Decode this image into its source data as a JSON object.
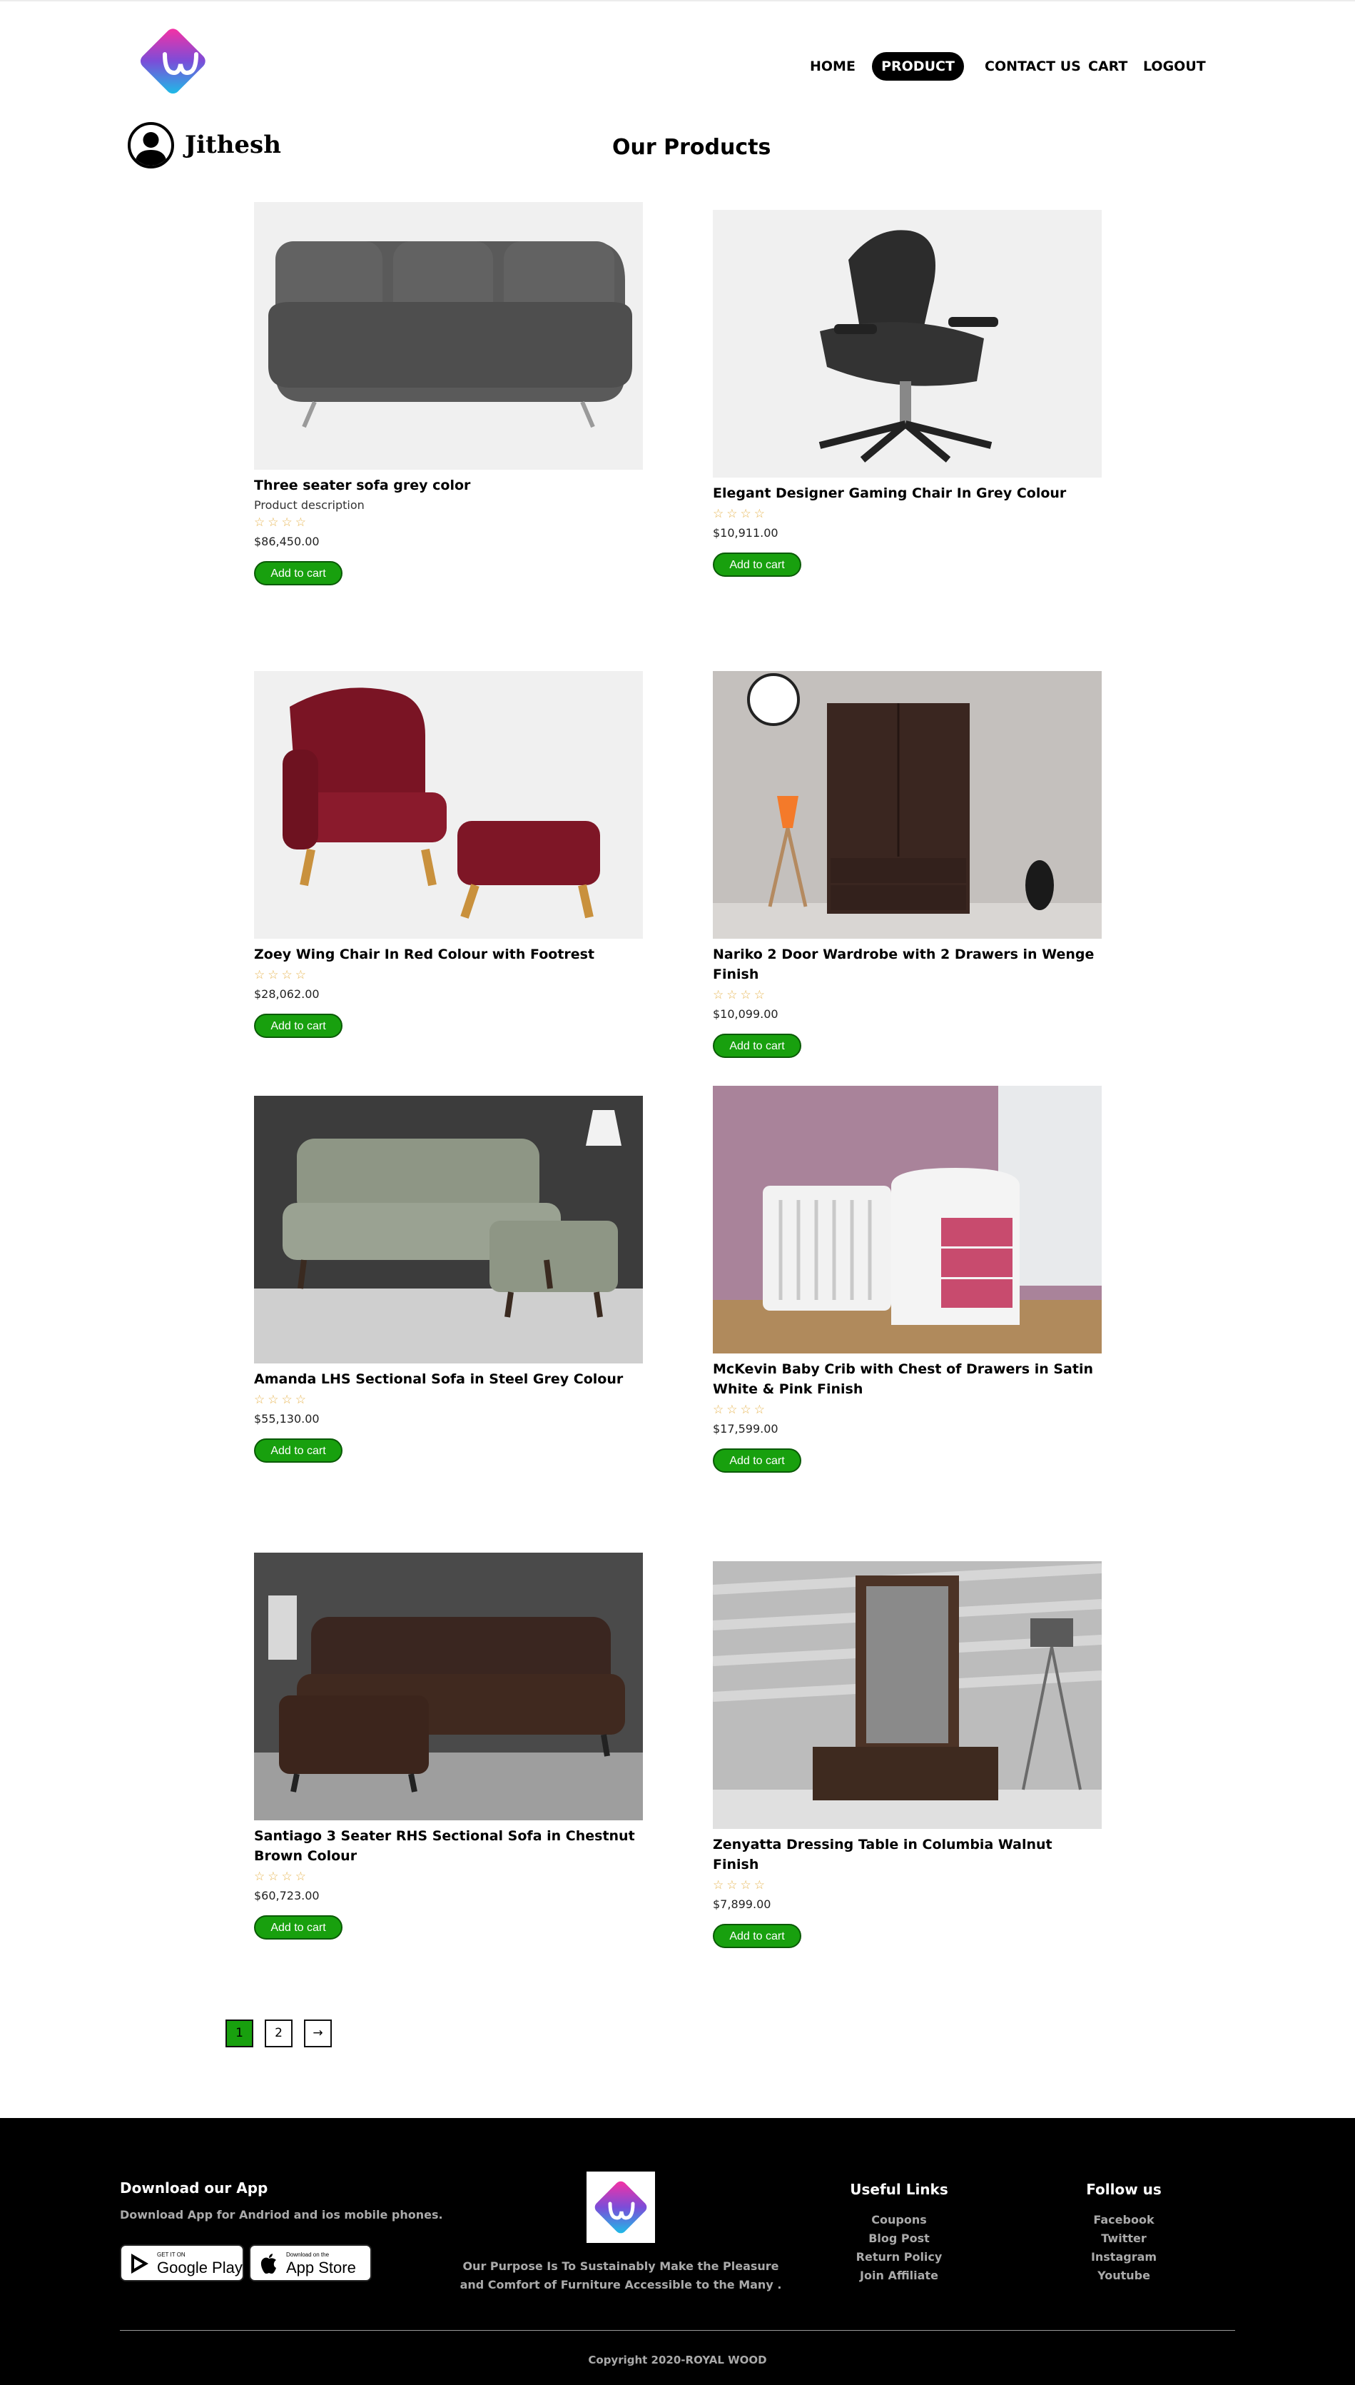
{
  "header": {
    "nav": [
      {
        "label": "HOME",
        "active": false
      },
      {
        "label": "PRODUCT",
        "active": true
      },
      {
        "label": "CONTACT US",
        "active": false
      },
      {
        "label": "CART",
        "active": false
      },
      {
        "label": "LOGOUT",
        "active": false
      }
    ],
    "username": "Jithesh",
    "page_title": "Our Products"
  },
  "products": [
    {
      "name": "Three seater sofa grey color",
      "description": "Product description",
      "stars": "☆☆☆☆",
      "price": "$86,450.00",
      "button": "Add to cart",
      "image": "grey-sofa"
    },
    {
      "name": "Elegant Designer Gaming Chair In Grey Colour",
      "stars": "☆☆☆☆",
      "price": "$10,911.00",
      "button": "Add to cart",
      "image": "gaming-chair"
    },
    {
      "name": "Zoey Wing Chair In Red Colour with Footrest",
      "stars": "☆☆☆☆",
      "price": "$28,062.00",
      "button": "Add to cart",
      "image": "red-wing-chair"
    },
    {
      "name": "Nariko 2 Door Wardrobe with 2 Drawers in Wenge Finish",
      "stars": "☆☆☆☆",
      "price": "$10,099.00",
      "button": "Add to cart",
      "image": "wardrobe"
    },
    {
      "name": "Amanda LHS Sectional Sofa in Steel Grey Colour",
      "stars": "☆☆☆☆",
      "price": "$55,130.00",
      "button": "Add to cart",
      "image": "sectional-grey"
    },
    {
      "name": "McKevin Baby Crib with Chest of Drawers in Satin White & Pink Finish",
      "stars": "☆☆☆☆",
      "price": "$17,599.00",
      "button": "Add to cart",
      "image": "baby-crib"
    },
    {
      "name": "Santiago 3 Seater RHS Sectional Sofa in Chestnut Brown Colour",
      "stars": "☆☆☆☆",
      "price": "$60,723.00",
      "button": "Add to cart",
      "image": "sectional-brown"
    },
    {
      "name": "Zenyatta Dressing Table in Columbia Walnut Finish",
      "stars": "☆☆☆☆",
      "price": "$7,899.00",
      "button": "Add to cart",
      "image": "dressing-table"
    }
  ],
  "pagination": {
    "pages": [
      "1",
      "2"
    ],
    "current": "1",
    "next": "→"
  },
  "footer": {
    "app_title": "Download our App",
    "app_desc": "Download App for Andriod and ios mobile phones.",
    "google_small": "GET IT ON",
    "google_big": "Google Play",
    "apple_small": "Download on the",
    "apple_big": "App Store",
    "purpose": "Our Purpose Is To Sustainably Make the Pleasure and Comfort of Furniture Accessible to the Many .",
    "useful_title": "Useful Links",
    "useful_links": [
      "Coupons",
      "Blog Post",
      "Return Policy",
      "Join Affiliate"
    ],
    "follow_title": "Follow us",
    "follow_links": [
      "Facebook",
      "Twitter",
      "Instagram",
      "Youtube"
    ],
    "copyright": "Copyright 2020-ROYAL WOOD"
  },
  "colors": {
    "accent_green": "#18a00e",
    "star_gold": "#e6b450",
    "footer_bg": "#000000"
  }
}
